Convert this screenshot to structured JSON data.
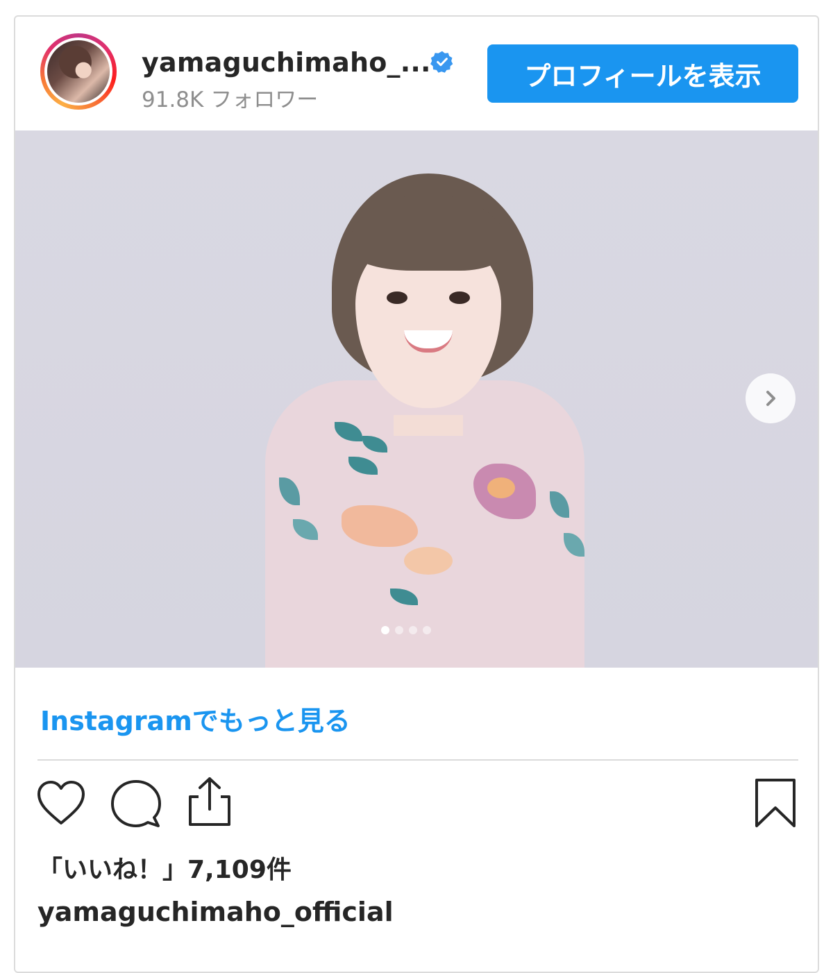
{
  "header": {
    "username": "yamaguchimaho_...",
    "followers": "91.8K フォロワー",
    "profile_button": "プロフィールを表示"
  },
  "post": {
    "carousel_current": 1,
    "carousel_total": 4
  },
  "more_link": "Instagramでもっと見る",
  "likes_text": "「いいね！」7,109件",
  "caption_username": "yamaguchimaho_official",
  "colors": {
    "accent": "#1a95f0",
    "text": "#262626",
    "muted": "#8e8e8e",
    "border": "#dbdbdb"
  },
  "icons": [
    "verified-badge-icon",
    "chevron-right-icon",
    "heart-icon",
    "comment-icon",
    "share-icon",
    "bookmark-icon"
  ]
}
